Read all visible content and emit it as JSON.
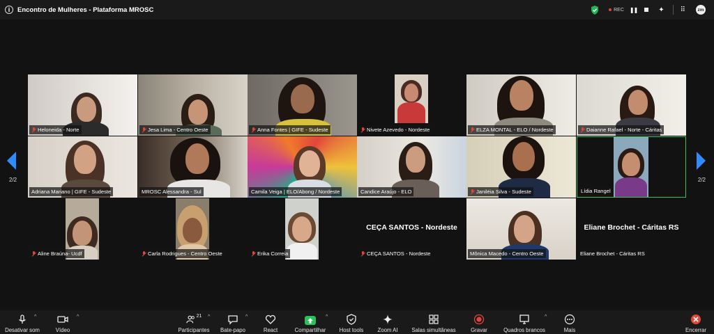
{
  "window": {
    "title": "Encontro de Mulheres - Plataforma MROSC"
  },
  "top_right": {
    "rec_label": "REC",
    "avatar_initials": "zm"
  },
  "navigation": {
    "page_left": "2/2",
    "page_right": "2/2"
  },
  "participants": [
    {
      "name": "Heloneida - Norte",
      "muted": true
    },
    {
      "name": "Jesa Lima - Centro Oeste",
      "muted": true
    },
    {
      "name": "Anna Fontes | GIFE - Sudeste",
      "muted": true
    },
    {
      "name": "Nivete Azevedo - Nordeste",
      "muted": true
    },
    {
      "name": "ELZA MONTAL - ELO / Nordeste",
      "muted": true
    },
    {
      "name": "Daianne Rafael - Norte - Cáritas",
      "muted": true
    },
    {
      "name": "Adriana Mariano | GIFE - Sudeste",
      "muted": false
    },
    {
      "name": "MROSC Alessandra - Sul",
      "muted": false
    },
    {
      "name": "Camila Veiga | ELO/Abong / Nordeste",
      "muted": false
    },
    {
      "name": "Candice Araújo - ELO",
      "muted": false
    },
    {
      "name": "Janiléia Silva - Sudeste",
      "muted": true
    },
    {
      "name": "Lídia Rangel",
      "muted": false,
      "active_speaker": true
    },
    {
      "name": "Aline Braúna- Ucdf",
      "muted": true
    },
    {
      "name": "Carla Rodrigues - Centro Oeste",
      "muted": true
    },
    {
      "name": "Erika Correia",
      "muted": true
    },
    {
      "name": "CEÇA SANTOS - Nordeste",
      "muted": true,
      "video_off": true,
      "display": "CEÇA SANTOS - Nordeste"
    },
    {
      "name": "Mônica Macedo - Centro Oeste",
      "muted": false
    },
    {
      "name": "Eliane Brochet - Cáritas RS",
      "muted": false,
      "video_off": true,
      "display": "Eliane Brochet - Cáritas RS"
    }
  ],
  "toolbar": {
    "mute": "Desativar som",
    "video": "Vídeo",
    "participants": "Participantes",
    "participants_count": "21",
    "chat": "Bate-papo",
    "react": "React",
    "share": "Compartilhar",
    "host_tools": "Host tools",
    "zoom_ai": "Zoom AI",
    "breakout": "Salas simultâneas",
    "record": "Gravar",
    "whiteboards": "Quadros brancos",
    "more": "Mais",
    "end": "Encerrar"
  },
  "colors": {
    "accent_blue": "#2d8cff",
    "rec_red": "#e0463a",
    "speaker_green": "#3fbf5a",
    "share_green": "#2bc15a",
    "shield_green": "#25b35a"
  }
}
